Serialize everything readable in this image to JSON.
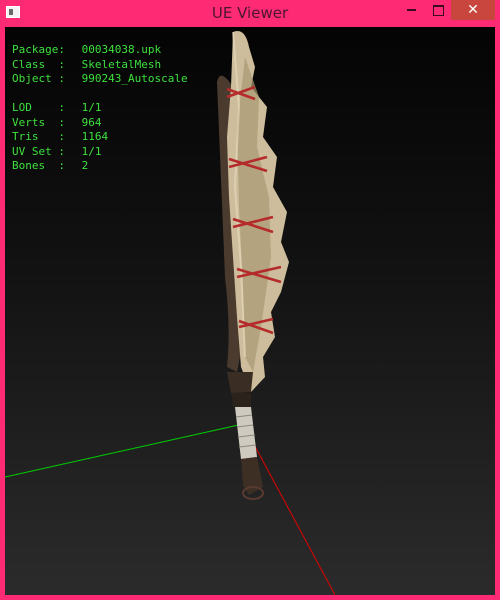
{
  "window": {
    "title": "UE Viewer"
  },
  "info": {
    "package_label": "Package:",
    "package_value": "00034038.upk",
    "class_label": "Class  :",
    "class_value": "SkeletalMesh",
    "object_label": "Object :",
    "object_value": "990243_Autoscale",
    "lod_label": "LOD    :",
    "lod_value": "1/1",
    "verts_label": "Verts  :",
    "verts_value": "964",
    "tris_label": "Tris   :",
    "tris_value": "1164",
    "uvset_label": "UV Set :",
    "uvset_value": "1/1",
    "bones_label": "Bones  :",
    "bones_value": "2"
  },
  "colors": {
    "frame": "#ff2a74",
    "info_text": "#3de03d",
    "axis_x": "#00d000",
    "axis_y": "#e00000"
  },
  "icons": {
    "app": "app-window-icon",
    "minimize": "minimize-icon",
    "maximize": "maximize-icon",
    "close": "close-icon"
  }
}
